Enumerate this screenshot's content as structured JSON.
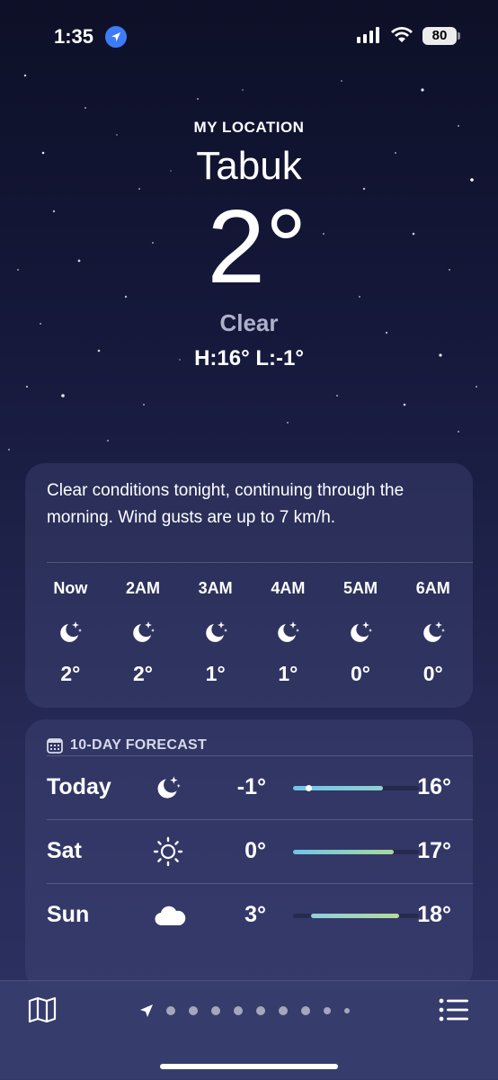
{
  "status_bar": {
    "time": "1:35",
    "battery": "80"
  },
  "location": {
    "label": "MY LOCATION",
    "city": "Tabuk",
    "temperature": "2°",
    "condition": "Clear",
    "high_low": "H:16°  L:-1°"
  },
  "summary": "Clear conditions tonight, continuing through the morning. Wind gusts are up to 7 km/h.",
  "hourly": [
    {
      "time": "Now",
      "icon": "moon-stars-icon",
      "temp": "2°"
    },
    {
      "time": "2AM",
      "icon": "moon-stars-icon",
      "temp": "2°"
    },
    {
      "time": "3AM",
      "icon": "moon-stars-icon",
      "temp": "1°"
    },
    {
      "time": "4AM",
      "icon": "moon-stars-icon",
      "temp": "1°"
    },
    {
      "time": "5AM",
      "icon": "moon-stars-icon",
      "temp": "0°"
    },
    {
      "time": "6AM",
      "icon": "moon-stars-icon",
      "temp": "0°"
    }
  ],
  "forecast": {
    "title": "10-DAY FORECAST",
    "days": [
      {
        "day": "Today",
        "icon": "moon-stars-icon",
        "low": "-1°",
        "high": "16°"
      },
      {
        "day": "Sat",
        "icon": "sun-icon",
        "low": "0°",
        "high": "17°"
      },
      {
        "day": "Sun",
        "icon": "cloud-icon",
        "low": "3°",
        "high": "18°"
      }
    ]
  },
  "colors": {
    "accent": "#3d7cf5",
    "bar_cool": "#6ec6e8",
    "bar_warm": "#a7d99a"
  }
}
